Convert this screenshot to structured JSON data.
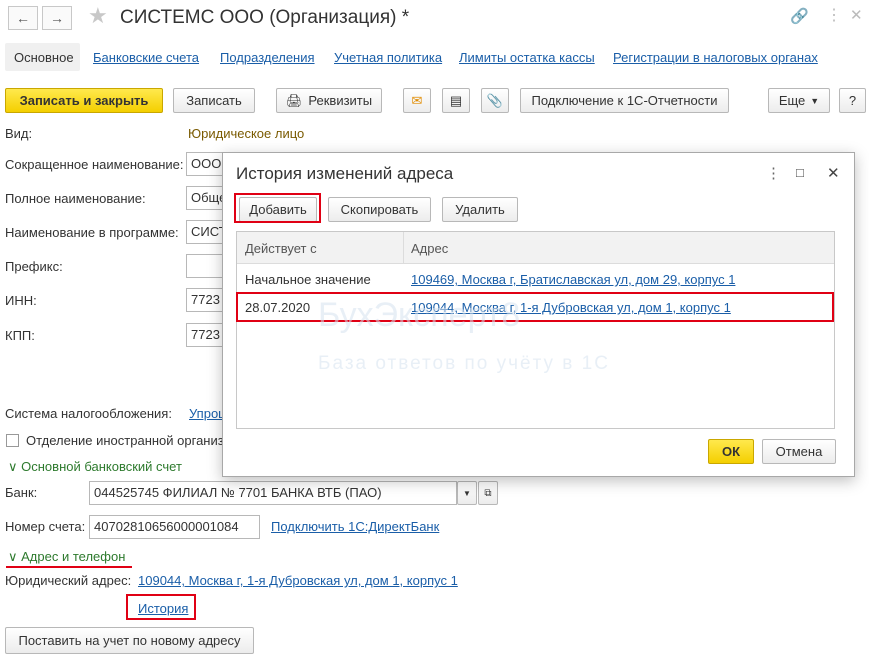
{
  "window": {
    "title": "СИСТЕМС ООО (Организация) *"
  },
  "tabs": [
    "Основное",
    "Банковские счета",
    "Подразделения",
    "Учетная политика",
    "Лимиты остатка кассы",
    "Регистрации в налоговых органах"
  ],
  "toolbar": {
    "save_close": "Записать и закрыть",
    "save": "Записать",
    "details": "Реквизиты",
    "connect": "Подключение к 1С-Отчетности",
    "more": "Еще",
    "help": "?"
  },
  "form": {
    "vid_label": "Вид:",
    "vid_value": "Юридическое лицо",
    "short_label": "Сокращенное наименование:",
    "short_value": "ООО",
    "full_label": "Полное наименование:",
    "full_value": "Обще",
    "prog_label": "Наименование в программе:",
    "prog_value": "СИСТ",
    "prefix_label": "Префикс:",
    "prefix_value": "",
    "inn_label": "ИНН:",
    "inn_value": "7723",
    "kpp_label": "КПП:",
    "kpp_value": "7723",
    "tax_label": "Система налогообложения:",
    "tax_value": "Упрощ",
    "foreign_label": "Отделение иностранной организ"
  },
  "bank": {
    "section": "Основной банковский счет",
    "bank_label": "Банк:",
    "bank_value": "044525745 ФИЛИАЛ № 7701 БАНКА ВТБ (ПАО)",
    "acc_label": "Номер счета:",
    "acc_value": "40702810656000001084",
    "direct_link": "Подключить 1С:ДиректБанк"
  },
  "address": {
    "section": "Адрес и телефон",
    "legal_label": "Юридический адрес:",
    "legal_value": "109044, Москва г, 1-я Дубровская ул, дом 1, корпус 1",
    "history_link": "История",
    "register_button": "Поставить на учет по новому адресу"
  },
  "dialog": {
    "title": "История изменений адреса",
    "add": "Добавить",
    "copy": "Скопировать",
    "delete": "Удалить",
    "columns": [
      "Действует с",
      "Адрес"
    ],
    "rows": [
      {
        "date": "Начальное значение",
        "address": "109469, Москва г, Братиславская ул, дом 29, корпус 1"
      },
      {
        "date": "28.07.2020",
        "address": "109044, Москва г, 1-я Дубровская ул, дом 1, корпус 1"
      }
    ],
    "ok": "ОК",
    "cancel": "Отмена"
  },
  "watermark": {
    "brand": "БухЭксперт8",
    "tagline": "База ответов по учёту в 1С"
  },
  "colors": {
    "accent_yellow": "#f4cf00",
    "highlight_red": "#e00014",
    "link_blue": "#1a5ea8",
    "section_green": "#2d7a2d"
  }
}
